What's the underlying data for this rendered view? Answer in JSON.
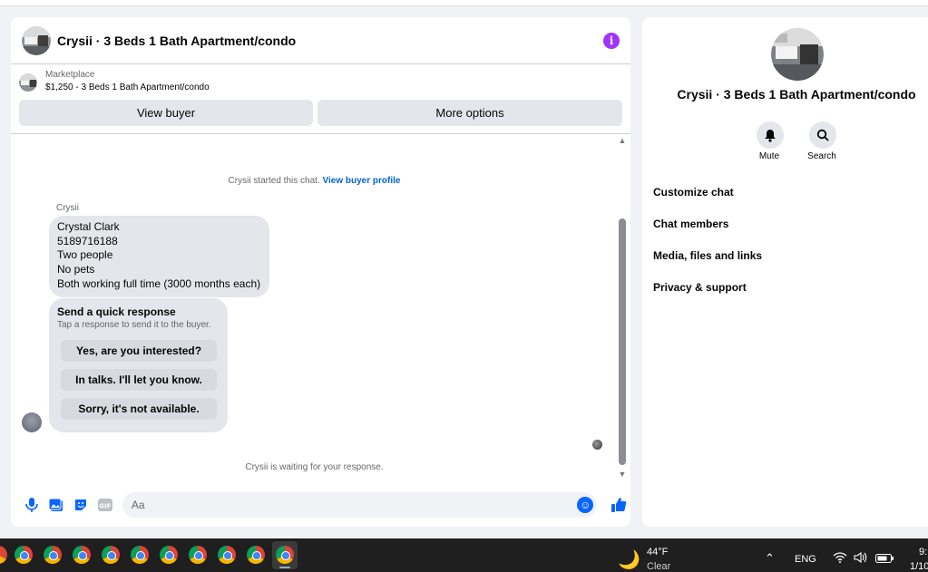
{
  "header": {
    "title": "Crysii · 3 Beds 1 Bath Apartment/condo",
    "info_icon": "info-icon"
  },
  "listing": {
    "source": "Marketplace",
    "summary": "$1,250 - 3 Beds 1 Bath Apartment/condo"
  },
  "actions": {
    "view_buyer": "View buyer",
    "more_options": "More options"
  },
  "conversation": {
    "started_prefix": "Crysii started this chat.",
    "view_profile": "View buyer profile",
    "sender": "Crysii",
    "message_lines": [
      "Crystal Clark",
      "5189716188",
      "Two people",
      "No pets",
      "Both working full time (3000 months each)"
    ],
    "quick_response": {
      "title": "Send a quick response",
      "subtitle": "Tap a response to send it to the buyer.",
      "options": [
        "Yes, are you interested?",
        "In talks. I'll let you know.",
        "Sorry, it's not available."
      ]
    },
    "waiting": "Crysii is waiting for your response."
  },
  "composer": {
    "placeholder": "Aa",
    "icons": [
      "microphone-icon",
      "photo-icon",
      "sticker-icon",
      "gif-icon",
      "emoji-icon",
      "thumbs-up-icon"
    ]
  },
  "side_panel": {
    "title": "Crysii · 3 Beds 1 Bath Apartment/condo",
    "mute": "Mute",
    "search": "Search",
    "menu": [
      "Customize chat",
      "Chat members",
      "Media, files and links",
      "Privacy & support"
    ]
  },
  "taskbar": {
    "temperature": "44°F",
    "condition": "Clear",
    "language": "ENG",
    "clock_partial": "9:",
    "date_partial": "1/10"
  },
  "colors": {
    "accent": "#0866ff",
    "info": "#a033ff",
    "bubble": "#e4e6eb"
  }
}
